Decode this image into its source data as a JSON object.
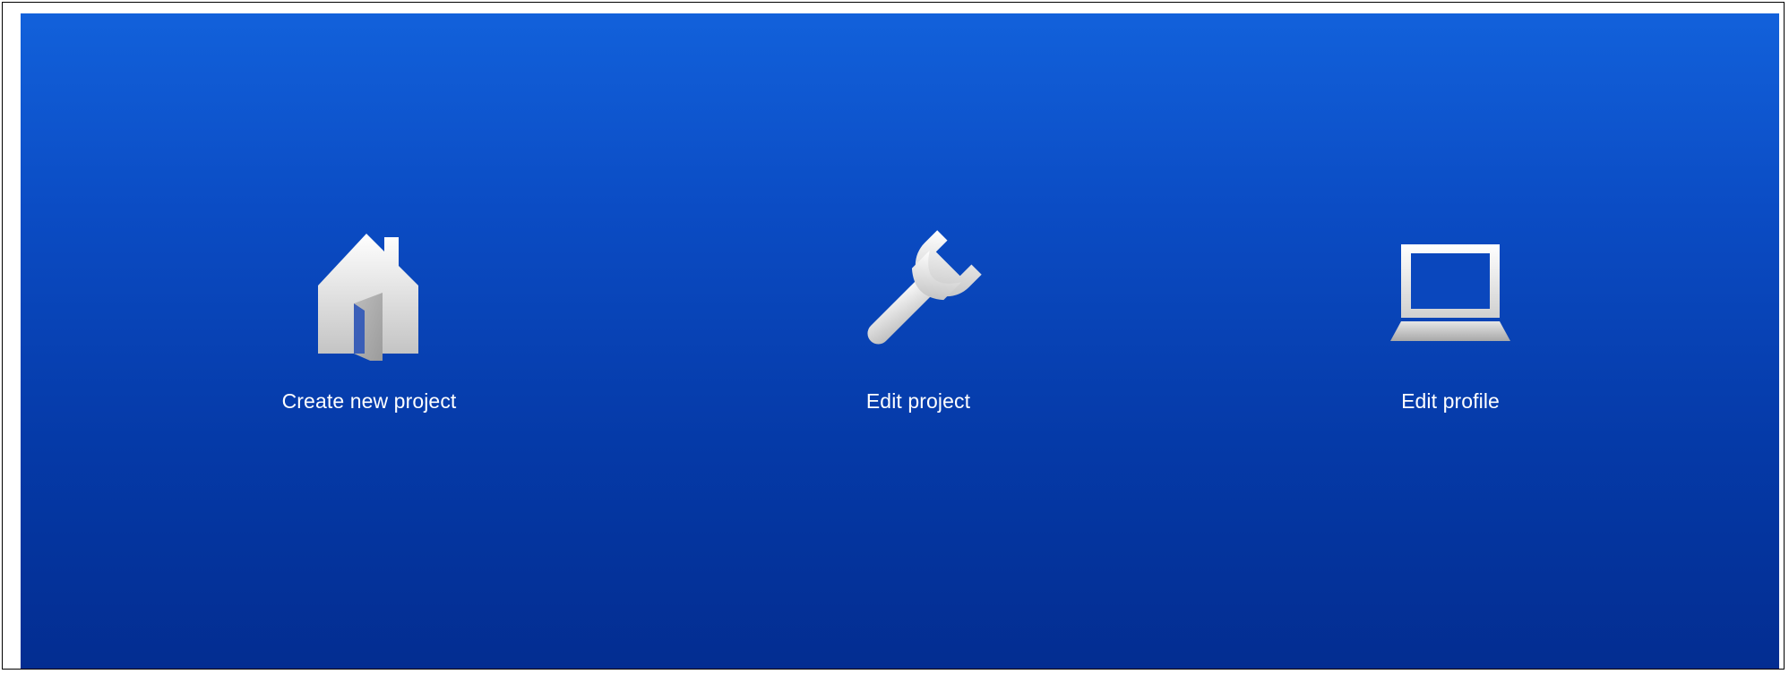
{
  "menu": {
    "items": [
      {
        "label": "Create new project",
        "icon": "house-icon"
      },
      {
        "label": "Edit project",
        "icon": "wrench-icon"
      },
      {
        "label": "Edit profile",
        "icon": "laptop-icon"
      }
    ]
  },
  "colors": {
    "background_top": "#1261db",
    "background_bottom": "#032d91",
    "icon_light": "#ffffff",
    "icon_shade": "#c9c9c9",
    "label_text": "#ffffff"
  }
}
